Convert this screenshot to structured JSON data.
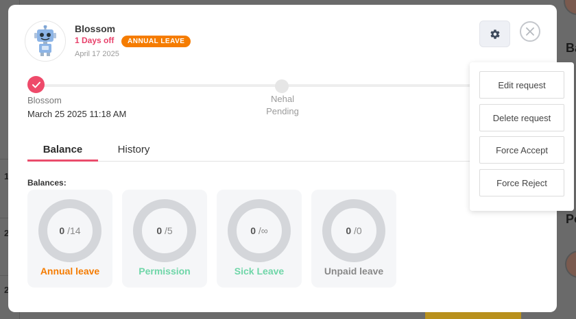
{
  "user": {
    "name": "Blossom",
    "days_off": "1 Days off",
    "leave_type_badge": "ANNUAL LEAVE",
    "request_date": "April 17 2025"
  },
  "timeline": {
    "steps": [
      {
        "name": "Blossom",
        "detail": "March 25 2025 11:18 AM",
        "state": "done"
      },
      {
        "name": "Nehal",
        "detail": "Pending",
        "state": "pending"
      }
    ]
  },
  "tabs": [
    {
      "label": "Balance",
      "active": true
    },
    {
      "label": "History",
      "active": false
    }
  ],
  "balances": {
    "label": "Balances:",
    "items": [
      {
        "used": "0",
        "total": "/14",
        "label": "Annual leave",
        "color": "#f57c00"
      },
      {
        "used": "0",
        "total": "/5",
        "label": "Permission",
        "color": "#6fd6a8"
      },
      {
        "used": "0",
        "total": "/∞",
        "label": "Sick Leave",
        "color": "#6fd6a8"
      },
      {
        "used": "0",
        "total": "/0",
        "label": "Unpaid leave",
        "color": "#888888"
      }
    ]
  },
  "menu": {
    "items": [
      "Edit request",
      "Delete request",
      "Force Accept",
      "Force Reject"
    ]
  },
  "background": {
    "right_labels": [
      "Ba",
      "Po"
    ],
    "left_digits": [
      "1",
      "2",
      "2"
    ]
  },
  "colors": {
    "accent": "#ea4c6c",
    "badge": "#f57c00",
    "done_step": "#ee4a6a"
  },
  "icons": {
    "settings": "gear-icon",
    "close": "close-icon",
    "done": "check-icon",
    "avatar": "robot-avatar-icon"
  }
}
